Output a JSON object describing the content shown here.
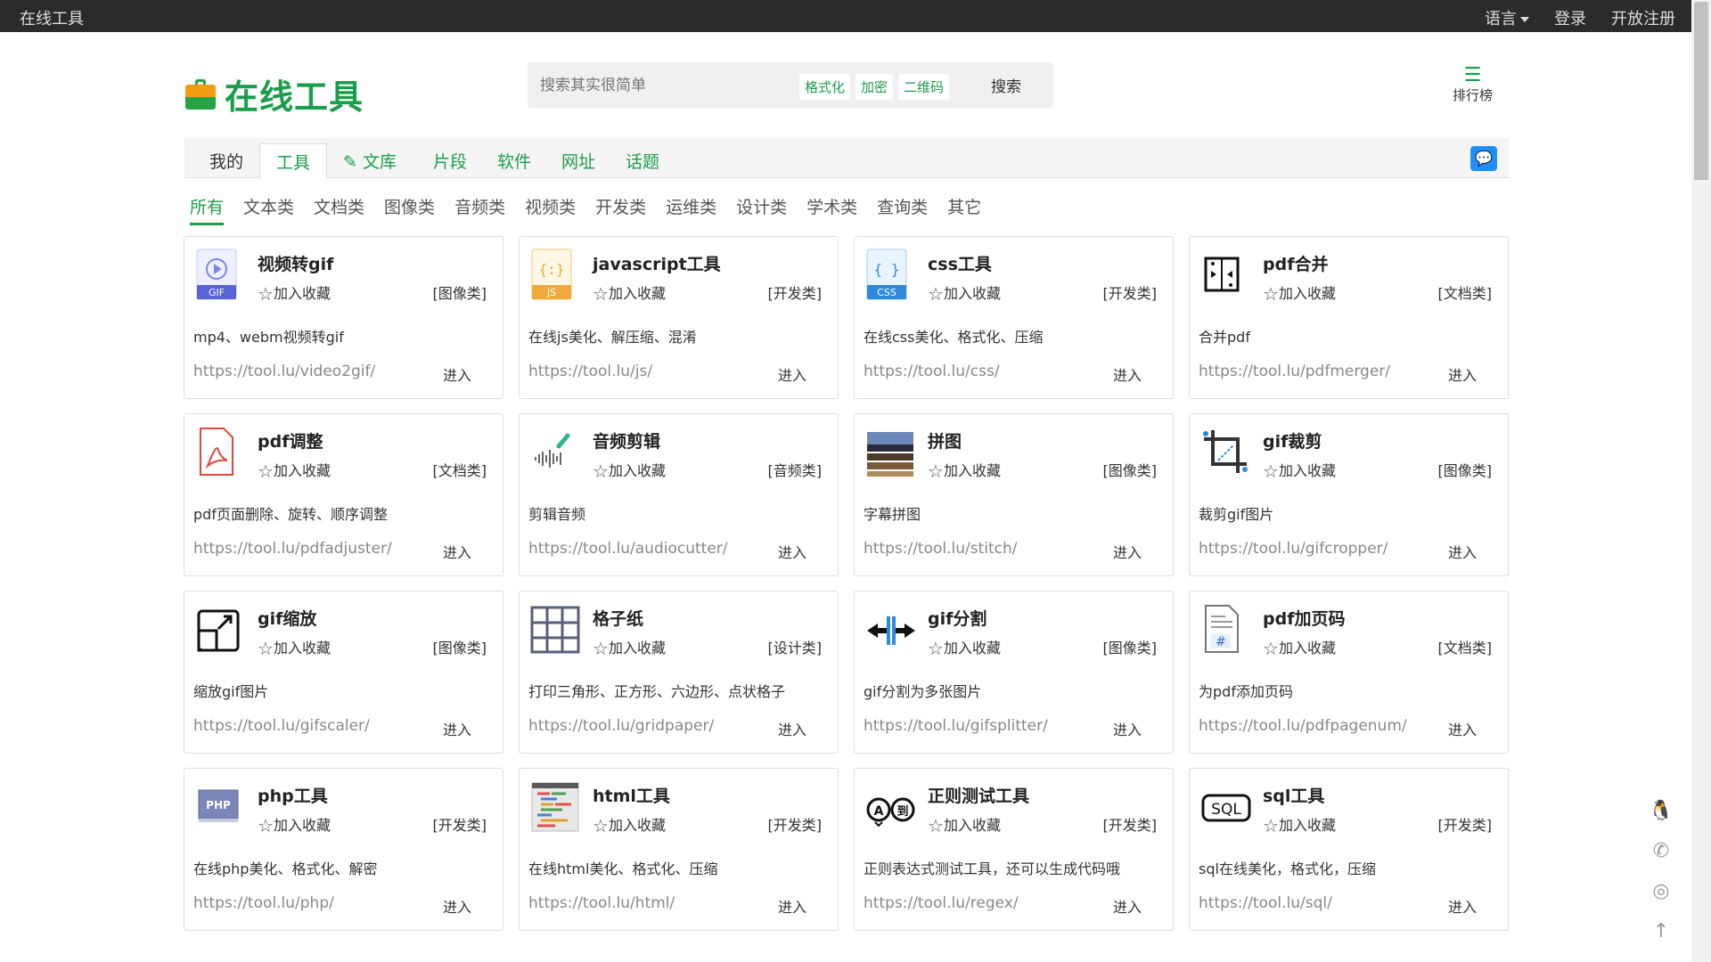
{
  "topbar": {
    "brand": "在线工具",
    "language": "语言",
    "login": "登录",
    "register": "开放注册"
  },
  "header": {
    "logo_text": "在线工具",
    "search_placeholder": "搜索其实很简单",
    "search_tags": [
      "格式化",
      "加密",
      "二维码"
    ],
    "search_button": "搜索",
    "rank_label": "排行榜"
  },
  "nav": {
    "tabs": [
      "我的",
      "工具",
      "文库",
      "片段",
      "软件",
      "网址",
      "话题"
    ],
    "active": "工具"
  },
  "categories": {
    "items": [
      "所有",
      "文本类",
      "文档类",
      "图像类",
      "音频类",
      "视频类",
      "开发类",
      "运维类",
      "设计类",
      "学术类",
      "查询类",
      "其它"
    ],
    "active": "所有"
  },
  "fav_label": "加入收藏",
  "go_label": "进入",
  "cards": [
    {
      "title": "视频转gif",
      "cat": "[图像类]",
      "desc": "mp4、webm视频转gif",
      "url": "https://tool.lu/video2gif/",
      "icon": "gif-video-icon"
    },
    {
      "title": "javascript工具",
      "cat": "[开发类]",
      "desc": "在线js美化、解压缩、混淆",
      "url": "https://tool.lu/js/",
      "icon": "js-file-icon"
    },
    {
      "title": "css工具",
      "cat": "[开发类]",
      "desc": "在线css美化、格式化、压缩",
      "url": "https://tool.lu/css/",
      "icon": "css-file-icon"
    },
    {
      "title": "pdf合并",
      "cat": "[文档类]",
      "desc": "合并pdf",
      "url": "https://tool.lu/pdfmerger/",
      "icon": "merge-icon"
    },
    {
      "title": "pdf调整",
      "cat": "[文档类]",
      "desc": "pdf页面删除、旋转、顺序调整",
      "url": "https://tool.lu/pdfadjuster/",
      "icon": "pdf-icon"
    },
    {
      "title": "音频剪辑",
      "cat": "[音频类]",
      "desc": "剪辑音频",
      "url": "https://tool.lu/audiocutter/",
      "icon": "audio-wave-icon"
    },
    {
      "title": "拼图",
      "cat": "[图像类]",
      "desc": "字幕拼图",
      "url": "https://tool.lu/stitch/",
      "icon": "stitch-photo-icon"
    },
    {
      "title": "gif裁剪",
      "cat": "[图像类]",
      "desc": "裁剪gif图片",
      "url": "https://tool.lu/gifcropper/",
      "icon": "crop-icon"
    },
    {
      "title": "gif缩放",
      "cat": "[图像类]",
      "desc": "缩放gif图片",
      "url": "https://tool.lu/gifscaler/",
      "icon": "scale-icon"
    },
    {
      "title": "格子纸",
      "cat": "[设计类]",
      "desc": "打印三角形、正方形、六边形、点状格子",
      "url": "https://tool.lu/gridpaper/",
      "icon": "grid-icon"
    },
    {
      "title": "gif分割",
      "cat": "[图像类]",
      "desc": "gif分割为多张图片",
      "url": "https://tool.lu/gifsplitter/",
      "icon": "split-icon"
    },
    {
      "title": "pdf加页码",
      "cat": "[文档类]",
      "desc": "为pdf添加页码",
      "url": "https://tool.lu/pdfpagenum/",
      "icon": "page-number-icon"
    },
    {
      "title": "php工具",
      "cat": "[开发类]",
      "desc": "在线php美化、格式化、解密",
      "url": "https://tool.lu/php/",
      "icon": "php-icon"
    },
    {
      "title": "html工具",
      "cat": "[开发类]",
      "desc": "在线html美化、格式化、压缩",
      "url": "https://tool.lu/html/",
      "icon": "html-code-icon"
    },
    {
      "title": "正则测试工具",
      "cat": "[开发类]",
      "desc": "正则表达式测试工具，还可以生成代码哦",
      "url": "https://tool.lu/regex/",
      "icon": "regex-icon"
    },
    {
      "title": "sql工具",
      "cat": "[开发类]",
      "desc": "sql在线美化，格式化，压缩",
      "url": "https://tool.lu/sql/",
      "icon": "sql-icon"
    }
  ]
}
